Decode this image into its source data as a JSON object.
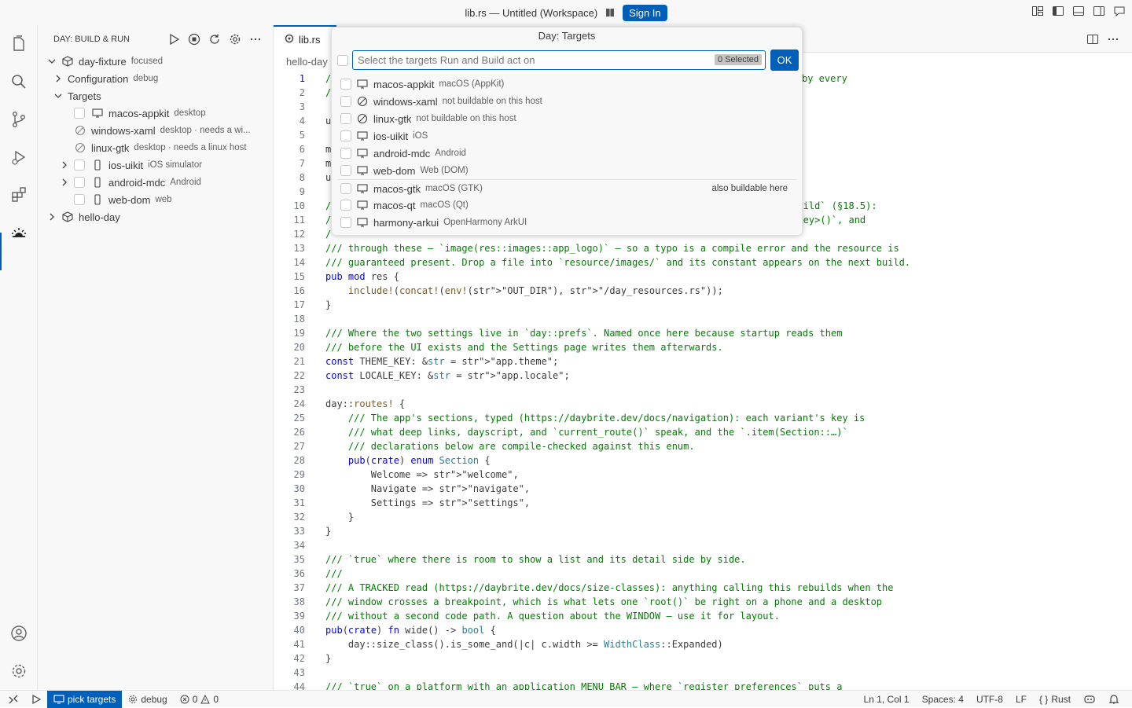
{
  "titlebar": {
    "title": "lib.rs — Untitled (Workspace)",
    "signin": "Sign In"
  },
  "sidebar": {
    "header": "DAY: BUILD & RUN",
    "rows": [
      {
        "label": "day-fixture",
        "sub": "focused"
      },
      {
        "label": "Configuration",
        "sub": "debug"
      },
      {
        "label": "Targets",
        "sub": ""
      },
      {
        "label": "macos-appkit",
        "sub": "desktop"
      },
      {
        "label": "windows-xaml",
        "sub": "desktop · needs a wi..."
      },
      {
        "label": "linux-gtk",
        "sub": "desktop · needs a linux host"
      },
      {
        "label": "ios-uikit",
        "sub": "iOS simulator"
      },
      {
        "label": "android-mdc",
        "sub": "Android"
      },
      {
        "label": "web-dom",
        "sub": "web"
      },
      {
        "label": "hello-day",
        "sub": ""
      }
    ]
  },
  "editor": {
    "tab": "lib.rs",
    "breadcrumb": "hello-day"
  },
  "quickpick": {
    "title": "Day: Targets",
    "placeholder": "Select the targets Run and Build act on",
    "count": "0 Selected",
    "ok": "OK",
    "items": [
      {
        "label": "macos-appkit",
        "sub": "macOS (AppKit)",
        "icon": "monitor-icon"
      },
      {
        "label": "windows-xaml",
        "sub": "not buildable on this host",
        "icon": "circle-slash-icon"
      },
      {
        "label": "linux-gtk",
        "sub": "not buildable on this host",
        "icon": "circle-slash-icon"
      },
      {
        "label": "ios-uikit",
        "sub": "iOS",
        "icon": "monitor-icon"
      },
      {
        "label": "android-mdc",
        "sub": "Android",
        "icon": "monitor-icon"
      },
      {
        "label": "web-dom",
        "sub": "Web (DOM)",
        "icon": "monitor-icon"
      },
      {
        "label": "macos-gtk",
        "sub": "macOS (GTK)",
        "icon": "monitor-icon"
      },
      {
        "label": "macos-qt",
        "sub": "macOS (Qt)",
        "icon": "monitor-icon"
      },
      {
        "label": "harmony-arkui",
        "sub": "OpenHarmony ArkUI",
        "icon": "monitor-icon"
      }
    ],
    "hint": "also buildable here"
  },
  "code": {
    "lines": [
      "/",
      "/",
      "",
      "u",
      "",
      "m",
      "m",
      "u",
      "",
      "/",
      "/",
      "/",
      "/// through these — `image(res::images::app_logo)` — so a typo is a compile error and the resource is",
      "/// guaranteed present. Drop a file into `resource/images/` and its constant appears on the next build.",
      "pub mod res {",
      "    include!(concat!(env!(\"OUT_DIR\"), \"/day_resources.rs\"));",
      "}",
      "",
      "/// Where the two settings live in `day::prefs`. Named once here because startup reads them",
      "/// before the UI exists and the Settings page writes them afterwards.",
      "const THEME_KEY: &str = \"app.theme\";",
      "const LOCALE_KEY: &str = \"app.locale\";",
      "",
      "day::routes! {",
      "    /// The app's sections, typed (https://daybrite.dev/docs/navigation): each variant's key is",
      "    /// what deep links, dayscript, and `current_route()` speak, and the `.item(Section::…)`",
      "    /// declarations below are compile-checked against this enum.",
      "    pub(crate) enum Section {",
      "        Welcome => \"welcome\",",
      "        Navigate => \"navigate\",",
      "        Settings => \"settings\",",
      "    }",
      "}",
      "",
      "/// `true` where there is room to show a list and its detail side by side.",
      "///",
      "/// A TRACKED read (https://daybrite.dev/docs/size-classes): anything calling this rebuilds when the",
      "/// window crosses a breakpoint, which is what lets one `root()` be right on a phone and a desktop",
      "/// without a second code path. A question about the WINDOW — use it for layout.",
      "pub(crate) fn wide() -> bool {",
      "    day::size_class().is_some_and(|c| c.width >= WidthClass::Expanded)",
      "}",
      "",
      "/// `true` on a platform with an application MENU BAR — where `register preferences` puts a"
    ],
    "right_fragments": {
      "line1": "by every",
      "line10": "-build` (§18.5):",
      "line11": ":<key>()`, and"
    }
  },
  "status": {
    "pick": "pick targets",
    "config": "debug",
    "errors": "0",
    "warnings": "0",
    "position": "Ln 1, Col 1",
    "spaces": "Spaces: 4",
    "encoding": "UTF-8",
    "eol": "LF",
    "lang": "Rust"
  }
}
